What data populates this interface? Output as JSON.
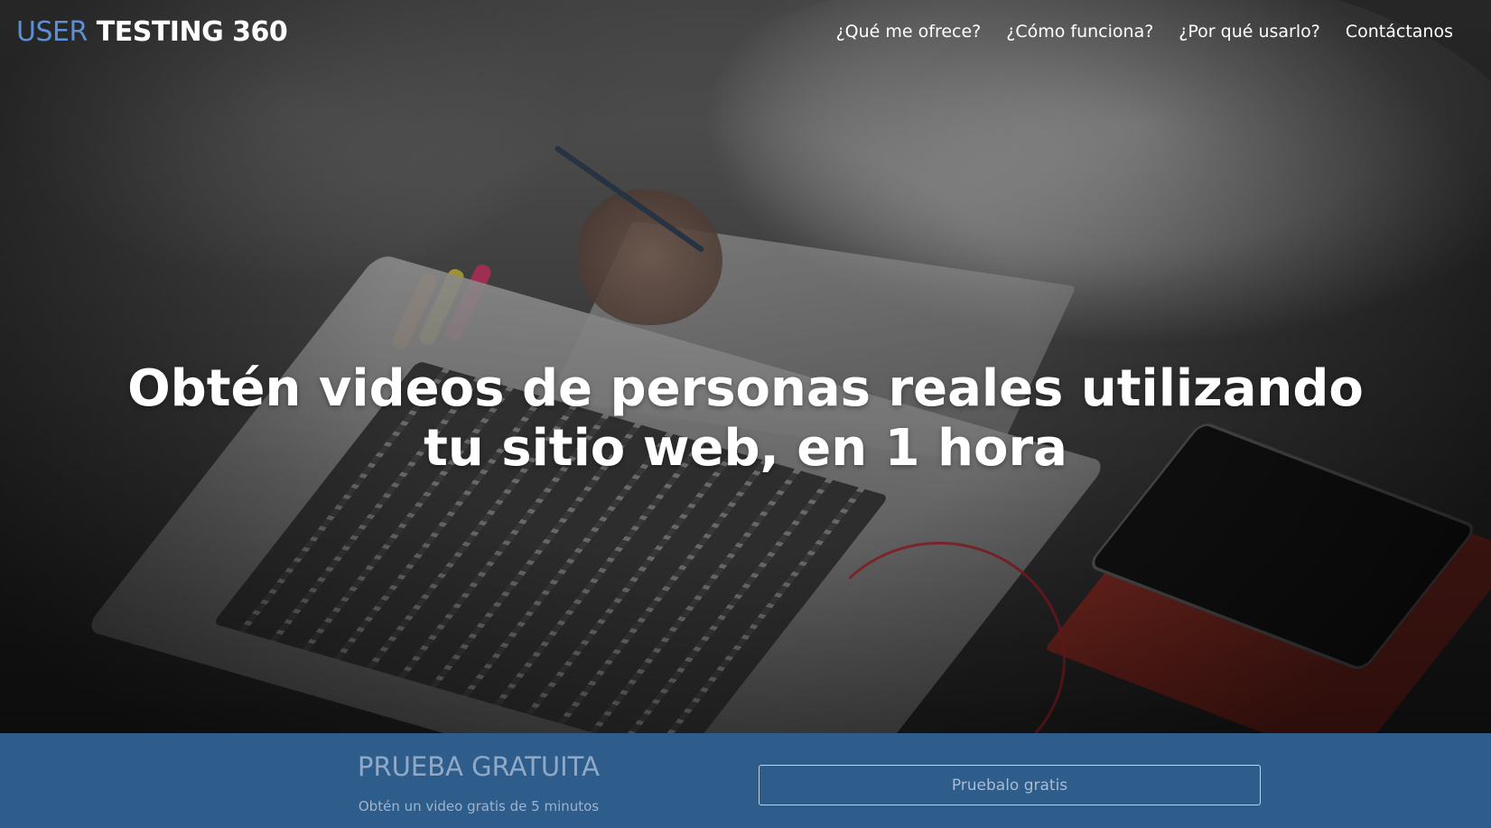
{
  "navbar": {
    "brand_part1": "USER",
    "brand_part2": "TESTING 360",
    "links": [
      {
        "label": "¿Qué me ofrece?"
      },
      {
        "label": "¿Cómo funciona?"
      },
      {
        "label": "¿Por qué usarlo?"
      },
      {
        "label": "Contáctanos"
      }
    ]
  },
  "hero": {
    "headline_line1": "Obtén videos de personas reales utilizando",
    "headline_line2": "tu sitio web, en 1 hora"
  },
  "cta": {
    "title": "PRUEBA GRATUITA",
    "subtitle": "Obtén un video gratis de 5 minutos",
    "button_label": "Pruebalo gratis"
  },
  "colors": {
    "brand_accent": "#5b8fd6",
    "cta_background": "#2e5d8c"
  }
}
